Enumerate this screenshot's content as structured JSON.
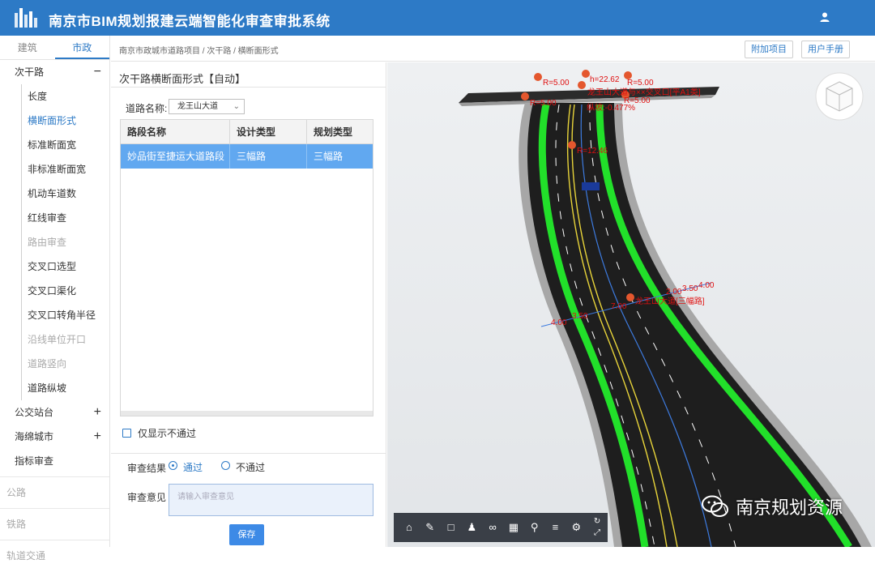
{
  "header": {
    "title": "南京市BIM规划报建云端智能化审查审批系统"
  },
  "sidebar": {
    "tabs": [
      {
        "label": "建筑"
      },
      {
        "label": "市政"
      }
    ],
    "groups": [
      {
        "label": "次干路",
        "toggle": "−"
      },
      {
        "label": "公交站台",
        "toggle": "+"
      },
      {
        "label": "海绵城市",
        "toggle": "+"
      },
      {
        "label": "指标审查"
      }
    ],
    "items": [
      {
        "label": "长度"
      },
      {
        "label": "横断面形式"
      },
      {
        "label": "标准断面宽"
      },
      {
        "label": "非标准断面宽"
      },
      {
        "label": "机动车道数"
      },
      {
        "label": "红线审查"
      },
      {
        "label": "路由审查"
      },
      {
        "label": "交叉口选型"
      },
      {
        "label": "交叉口渠化"
      },
      {
        "label": "交叉口转角半径"
      },
      {
        "label": "沿线单位开口"
      },
      {
        "label": "道路竖向"
      },
      {
        "label": "道路纵坡"
      }
    ],
    "bottom": [
      {
        "label": "公路"
      },
      {
        "label": "铁路"
      },
      {
        "label": "轨道交通"
      }
    ]
  },
  "breadcrumb": "南京市政城市道路项目 / 次干路 / 横断面形式",
  "top_buttons": {
    "attach": "附加项目",
    "manual": "用户手册"
  },
  "panel": {
    "title": "次干路横断面形式【自动】",
    "road_label": "道路名称:",
    "road_value": "龙王山大道",
    "columns": [
      "路段名称",
      "设计类型",
      "规划类型"
    ],
    "rows": [
      [
        "妙品街至捷运大道路段",
        "三幅路",
        "三幅路"
      ]
    ],
    "only_failed": "仅显示不通过",
    "result_label": "审查结果",
    "pass": "通过",
    "fail": "不通过",
    "opinion_label": "审查意见",
    "opinion_placeholder": "请输入审查意见",
    "save": "保存"
  },
  "viewport": {
    "annotations": {
      "r1": "R=5.00",
      "h": "h=22.62",
      "r2": "R=5.00",
      "r3": "R=5.00",
      "r4": "R=5.00",
      "intersection": "龙王山大道与××交叉口[平A1类]",
      "slope": "纵坡:-0.477%",
      "r5": "R=12.46",
      "w1": "4.00",
      "w2": "3.50",
      "w3": "7.00",
      "w4": "2.00",
      "w5": "3.50",
      "w6": "4.00",
      "section": "龙王山大道[三幅路]"
    },
    "watermark": "南京规划资源"
  },
  "colors": {
    "header": "#2d7ac6",
    "selected_row": "#61a8f0",
    "green_lane": "#22e02a",
    "annotation": "#e01010"
  },
  "icons": [
    "home-icon",
    "ruler-icon",
    "area-icon",
    "person-icon",
    "link-icon",
    "grid-icon",
    "pin-icon",
    "layers-icon",
    "settings-icon",
    "refresh-icon",
    "fullscreen-icon"
  ]
}
